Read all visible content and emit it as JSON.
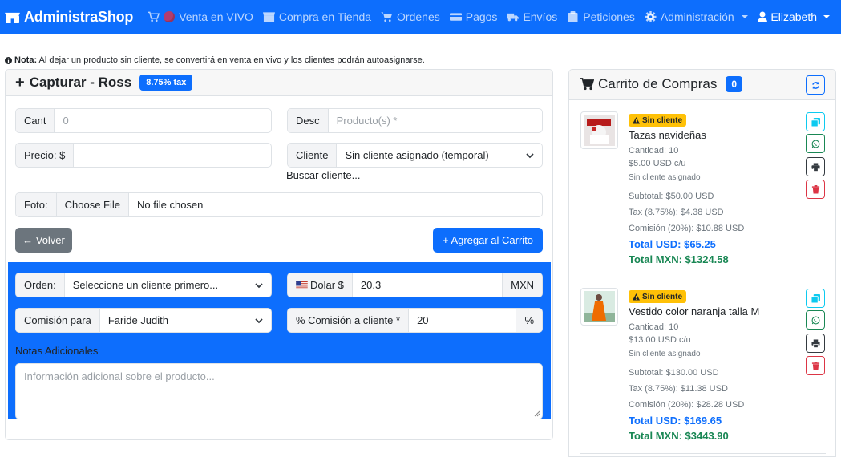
{
  "navbar": {
    "brand": "AdministraShop",
    "items": [
      {
        "label": "Venta en VIVO"
      },
      {
        "label": "Compra en Tienda"
      },
      {
        "label": "Ordenes"
      },
      {
        "label": "Pagos"
      },
      {
        "label": "Envíos"
      },
      {
        "label": "Peticiones"
      },
      {
        "label": "Administración"
      }
    ],
    "user": "Elizabeth"
  },
  "note": {
    "bold": "Nota:",
    "text": " Al dejar un producto sin cliente, se convertirá en venta en vivo y los clientes podrán autoasignarse."
  },
  "capture": {
    "title": "Capturar - Ross",
    "tax_badge": "8.75% tax",
    "cant_label": "Cant",
    "cant_placeholder": "0",
    "desc_label": "Desc",
    "desc_placeholder": "Producto(s) *",
    "precio_label": "Precio: $",
    "precio_value": "",
    "cliente_label": "Cliente",
    "cliente_value": "Sin cliente asignado (temporal)",
    "buscar_cliente": "Buscar cliente...",
    "foto_label": "Foto:",
    "file_button": "Choose File",
    "file_status": "No file chosen",
    "back_button": "← Volver",
    "add_button": "+ Agregar al Carrito",
    "orden_label": "Orden:",
    "orden_value": "Seleccione un cliente primero...",
    "dolar_label": "Dolar $",
    "dolar_value": "20.3",
    "dolar_unit": "MXN",
    "comision_para_label": "Comisión para",
    "comision_para_value": "Faride Judith",
    "pct_comision_label": "% Comisión a cliente *",
    "pct_comision_value": "20",
    "pct_unit": "%",
    "notas_label": "Notas Adicionales",
    "notas_placeholder": "Información adicional sobre el producto..."
  },
  "cart": {
    "title": "Carrito de Compras",
    "count": "0",
    "items": [
      {
        "badge": "Sin cliente",
        "title": "Tazas navideñas",
        "cantidad": "Cantidad: 10",
        "unit_price": "$5.00 USD c/u",
        "client": "Sin cliente asignado",
        "subtotal": "Subtotal: $50.00 USD",
        "tax": "Tax (8.75%): $4.38 USD",
        "comision": "Comisión (20%): $10.88 USD",
        "total_usd": "Total USD: $65.25",
        "total_mxn": "Total MXN: $1324.58"
      },
      {
        "badge": "Sin cliente",
        "title": "Vestido color naranja talla M",
        "cantidad": "Cantidad: 10",
        "unit_price": "$13.00 USD c/u",
        "client": "Sin cliente asignado",
        "subtotal": "Subtotal: $130.00 USD",
        "tax": "Tax (8.75%): $11.38 USD",
        "comision": "Comisión (20%): $28.28 USD",
        "total_usd": "Total USD: $169.65",
        "total_mxn": "Total MXN: $3443.90"
      }
    ]
  },
  "colors": {
    "primary": "#0d6efd",
    "secondary": "#6c757d",
    "warning": "#ffc107",
    "success": "#198754",
    "danger": "#dc3545",
    "info": "#0dcaf0"
  },
  "icons": [
    "shop-icon",
    "cart-icon",
    "live-dot-icon",
    "store-icon",
    "money-icon",
    "truck-icon",
    "clipboard-icon",
    "gear-icon",
    "user-icon",
    "info-icon",
    "refresh-icon",
    "warning-icon",
    "copy-icon",
    "whatsapp-icon",
    "printer-icon",
    "trash-icon",
    "chevron-down-icon",
    "flag-icon"
  ]
}
